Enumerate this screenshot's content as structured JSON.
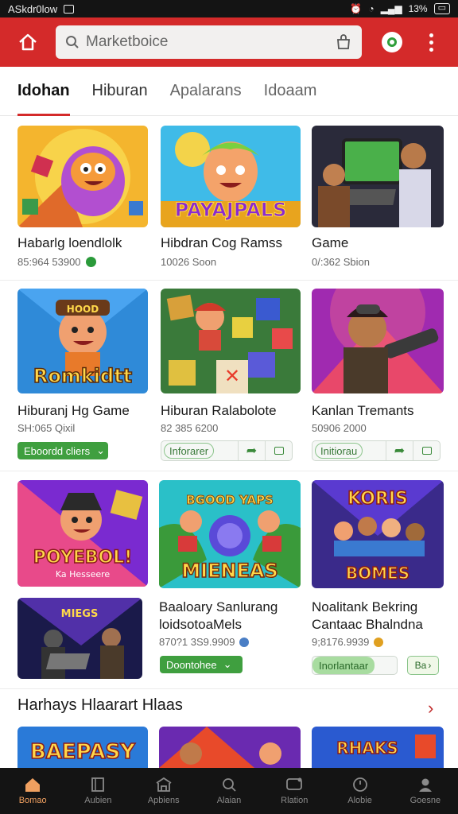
{
  "status": {
    "left_text": "ASkdr0low",
    "battery": "13%"
  },
  "search": {
    "placeholder": "Marketboice"
  },
  "tabs": [
    {
      "label": "Idohan",
      "active": true
    },
    {
      "label": "Hiburan",
      "active": false
    },
    {
      "label": "Apalarans",
      "active": false
    },
    {
      "label": "Idoaam",
      "active": false
    }
  ],
  "rows": [
    [
      {
        "title": "Habarlg loendlolk",
        "meta": "85:964 53900"
      },
      {
        "title": "Hibdran Cog Ramss",
        "meta": "10026 Soon"
      },
      {
        "title": "Game",
        "meta": "0/:362 Sbion"
      }
    ],
    [
      {
        "title": "Hiburanj Hg Game",
        "meta": "SH:065 Qixil",
        "button": "Eboordd cliers"
      },
      {
        "title": "Hiburan Ralabolote",
        "meta": "82 385 6200",
        "chip": "Inforarer"
      },
      {
        "title": "Kanlan Tremants",
        "meta": "50906 2000",
        "chip": "Initiorau"
      }
    ],
    [
      {
        "title": "Baaloary Sanlurang",
        "title2": "loidsotoaMels",
        "meta": "870?1 3S9.9909",
        "button": "Doontohee"
      },
      {
        "title": "Noalitank Bekring",
        "title2": "Cantaac Bhalndna",
        "meta": "9;8176.9939",
        "chip": "Inorlantaar",
        "chip_right": "Ba"
      }
    ]
  ],
  "thumb_text": {
    "t2": "PAYAJPALS",
    "t4": "Romkidtt",
    "t4b": "HOOD",
    "t7": "POYEBOL!",
    "t7b": "Ka Hesseere",
    "t8": "MIENEAS",
    "t8b": "BGOOD YAPS",
    "t9": "KORIS",
    "t9b": "BOMES",
    "t10": "MIEGS",
    "t11": "BAEPASY",
    "t13": "RHAKS"
  },
  "section": {
    "title": "Harhays Hlaarart Hlaas"
  },
  "bottom_nav": [
    {
      "label": "Bomao",
      "active": true
    },
    {
      "label": "Aubien",
      "active": false
    },
    {
      "label": "Apbiens",
      "active": false
    },
    {
      "label": "Alaian",
      "active": false
    },
    {
      "label": "Rlation",
      "active": false
    },
    {
      "label": "Alobie",
      "active": false
    },
    {
      "label": "Goesne",
      "active": false
    }
  ],
  "colors": {
    "brand": "#d42a2a",
    "accent_green": "#3f9f3f",
    "nav_active": "#f0a060"
  }
}
